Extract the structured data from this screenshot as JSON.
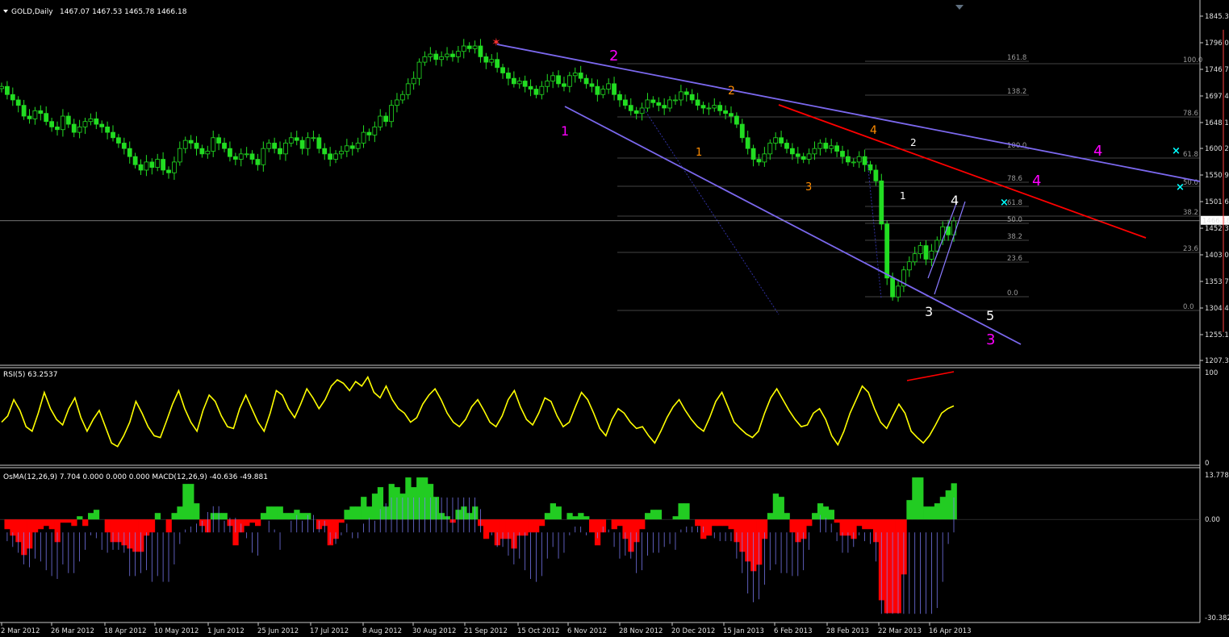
{
  "chart_data": [
    {
      "type": "candlestick",
      "title": "GOLD,Daily",
      "ohlc_readout": "1467.07 1467.53 1465.78 1466.18",
      "price_axis_ticks": [
        "1845.3",
        "1796.0",
        "1746.7",
        "1697.4",
        "1648.1",
        "1600.2",
        "1550.9",
        "1501.6",
        "1452.3",
        "1403.0",
        "1353.7",
        "1304.4",
        "1255.1",
        "1207.3"
      ],
      "ylim": [
        1207.3,
        1845.3
      ],
      "current_price_label": "1466.18",
      "x_axis_ticks": [
        "2 Mar 2012",
        "26 Mar 2012",
        "18 Apr 2012",
        "10 May 2012",
        "1 Jun 2012",
        "25 Jun 2012",
        "17 Jul 2012",
        "8 Aug 2012",
        "30 Aug 2012",
        "21 Sep 2012",
        "15 Oct 2012",
        "6 Nov 2012",
        "28 Nov 2012",
        "20 Dec 2012",
        "15 Jan 2013",
        "6 Feb 2013",
        "28 Feb 2013",
        "22 Mar 2013",
        "16 Apr 2013"
      ],
      "close_series": [
        1715,
        1700,
        1690,
        1680,
        1660,
        1655,
        1670,
        1665,
        1650,
        1640,
        1635,
        1660,
        1645,
        1630,
        1640,
        1650,
        1655,
        1645,
        1640,
        1630,
        1620,
        1610,
        1600,
        1585,
        1570,
        1560,
        1575,
        1565,
        1580,
        1560,
        1555,
        1575,
        1600,
        1615,
        1610,
        1600,
        1590,
        1595,
        1620,
        1610,
        1600,
        1585,
        1580,
        1590,
        1590,
        1580,
        1570,
        1600,
        1610,
        1600,
        1590,
        1610,
        1620,
        1615,
        1600,
        1620,
        1620,
        1600,
        1590,
        1580,
        1590,
        1595,
        1605,
        1600,
        1610,
        1630,
        1625,
        1640,
        1660,
        1650,
        1680,
        1690,
        1700,
        1720,
        1730,
        1760,
        1770,
        1775,
        1765,
        1770,
        1775,
        1770,
        1780,
        1790,
        1785,
        1790,
        1770,
        1760,
        1765,
        1750,
        1740,
        1730,
        1720,
        1725,
        1715,
        1710,
        1700,
        1715,
        1725,
        1735,
        1720,
        1715,
        1735,
        1740,
        1730,
        1720,
        1715,
        1700,
        1710,
        1720,
        1700,
        1690,
        1680,
        1670,
        1665,
        1675,
        1690,
        1685,
        1680,
        1675,
        1690,
        1690,
        1705,
        1700,
        1690,
        1680,
        1675,
        1675,
        1680,
        1670,
        1665,
        1660,
        1645,
        1620,
        1600,
        1580,
        1575,
        1590,
        1610,
        1620,
        1610,
        1600,
        1590,
        1585,
        1580,
        1590,
        1600,
        1610,
        1600,
        1605,
        1595,
        1585,
        1575,
        1575,
        1585,
        1570,
        1560,
        1540,
        1460,
        1360,
        1325,
        1345,
        1375,
        1390,
        1405,
        1420,
        1395,
        1410,
        1430,
        1455,
        1440,
        1466
      ],
      "wave_labels": [
        {
          "text": "2",
          "color": "#ff00ff"
        },
        {
          "text": "1",
          "color": "#ff00ff"
        },
        {
          "text": "3",
          "color": "#ff00ff"
        },
        {
          "text": "4",
          "color": "#ff00ff"
        },
        {
          "text": "4",
          "color": "#ff00ff"
        },
        {
          "text": "2",
          "color": "#ff8c00"
        },
        {
          "text": "1",
          "color": "#ff8c00"
        },
        {
          "text": "3",
          "color": "#ff8c00"
        },
        {
          "text": "4",
          "color": "#ff8c00"
        },
        {
          "text": "2",
          "color": "#ffffff"
        },
        {
          "text": "1",
          "color": "#ffffff"
        },
        {
          "text": "3",
          "color": "#ffffff"
        },
        {
          "text": "4",
          "color": "#ffffff"
        },
        {
          "text": "5",
          "color": "#ffffff"
        }
      ],
      "fib_levels_left": [
        "161.8",
        "138.2",
        "100.0",
        "78.6",
        "61.8",
        "50.0",
        "38.2",
        "23.6",
        "0.0"
      ],
      "fib_levels_right": [
        "100.0",
        "78.6",
        "61.8",
        "50.0",
        "38.2",
        "23.6",
        "0.0"
      ],
      "colors": {
        "bull": "#22dd22",
        "bear": "#22dd22",
        "trend_blue": "#7b68ee",
        "trend_red": "#ff0000",
        "fib": "#888888",
        "cross": "#00ffff"
      }
    },
    {
      "type": "line",
      "title": "RSI(5) 63.2537",
      "ylim": [
        0,
        100
      ],
      "ticks": [
        "100",
        "0"
      ],
      "series": [
        {
          "values": [
            45,
            52,
            70,
            58,
            40,
            35,
            55,
            78,
            60,
            48,
            42,
            60,
            72,
            50,
            35,
            48,
            58,
            40,
            22,
            18,
            30,
            45,
            68,
            55,
            40,
            30,
            28,
            46,
            65,
            80,
            60,
            45,
            35,
            58,
            75,
            68,
            52,
            40,
            38,
            60,
            75,
            60,
            45,
            35,
            55,
            80,
            75,
            60,
            50,
            65,
            82,
            72,
            60,
            70,
            85,
            92,
            88,
            80,
            90,
            85,
            95,
            78,
            72,
            85,
            70,
            60,
            55,
            45,
            50,
            65,
            75,
            82,
            70,
            55,
            45,
            40,
            48,
            62,
            70,
            58,
            45,
            40,
            52,
            70,
            80,
            62,
            48,
            42,
            55,
            72,
            68,
            52,
            40,
            45,
            62,
            78,
            70,
            55,
            38,
            30,
            48,
            60,
            55,
            45,
            38,
            40,
            30,
            22,
            35,
            50,
            62,
            70,
            58,
            48,
            40,
            35,
            50,
            68,
            78,
            62,
            45,
            38,
            32,
            28,
            35,
            55,
            72,
            82,
            70,
            58,
            48,
            40,
            42,
            55,
            60,
            48,
            30,
            20,
            35,
            55,
            70,
            85,
            78,
            60,
            45,
            38,
            52,
            65,
            55,
            35,
            28,
            22,
            30,
            42,
            55,
            60,
            63
          ]
        }
      ],
      "color": "#ffff00",
      "divergence_line_color": "#ff0000"
    },
    {
      "type": "bar",
      "title": "OsMA(12,26,9) 7.704 0.000 0.000 0.000  MACD(12,26,9) -40.636 -49.881",
      "ticks": [
        "13.778",
        "0.00",
        "-30.382"
      ],
      "ylim": [
        -30.382,
        13.778
      ],
      "colors": {
        "positive": "#22cc22",
        "negative": "#ff0000",
        "macd": "#8080ff"
      }
    }
  ]
}
